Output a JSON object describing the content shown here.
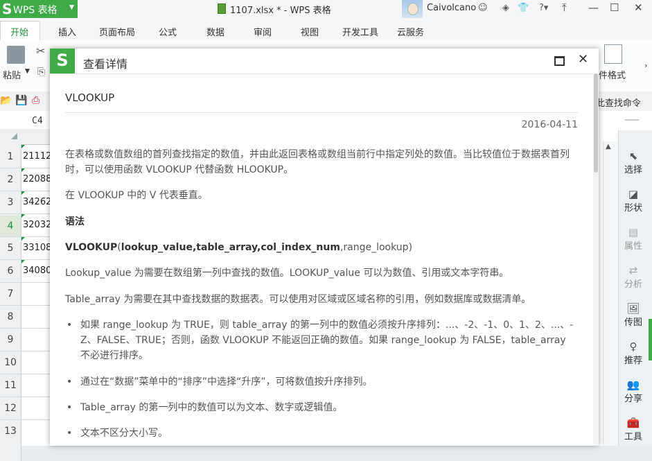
{
  "app": {
    "logo_letter": "S",
    "name": "WPS 表格",
    "window_title": "1107.xlsx * - WPS 表格",
    "username": "Caivolcano"
  },
  "ribbon_tabs": [
    "开始",
    "插入",
    "页面布局",
    "公式",
    "数据",
    "审阅",
    "视图",
    "开发工具",
    "云服务"
  ],
  "ribbon": {
    "paste_label": "粘贴",
    "cell_format_label": "件格式",
    "find_command_label": "此查找命令"
  },
  "sheet": {
    "name_box": "C4",
    "rows": [
      "1",
      "2",
      "3",
      "4",
      "5",
      "6",
      "7",
      "8",
      "9",
      "10",
      "11",
      "12",
      "13"
    ],
    "active_row": "4",
    "cells": [
      "21112",
      "22088",
      "34262",
      "32032",
      "33108",
      "34080"
    ]
  },
  "right_pane": [
    {
      "label": "选择",
      "icon": "cursor-icon",
      "enabled": true
    },
    {
      "label": "形状",
      "icon": "shapes-icon",
      "enabled": true
    },
    {
      "label": "属性",
      "icon": "properties-icon",
      "enabled": false
    },
    {
      "label": "分析",
      "icon": "analysis-icon",
      "enabled": false
    },
    {
      "label": "传图",
      "icon": "image-upload-icon",
      "enabled": true
    },
    {
      "label": "推荐",
      "icon": "recommend-icon",
      "enabled": true
    },
    {
      "label": "分享",
      "icon": "share-icon",
      "enabled": true
    },
    {
      "label": "工具",
      "icon": "toolbox-icon",
      "enabled": true
    }
  ],
  "dialog": {
    "logo_letter": "S",
    "title": "查看详情",
    "function_name": "VLOOKUP",
    "date": "2016-04-11",
    "para1": "在表格或数值数组的首列查找指定的数值，并由此返回表格或数组当前行中指定列处的数值。当比较值位于数据表首列时，可以使用函数 VLOOKUP 代替函数 HLOOKUP。",
    "para2": "在 VLOOKUP 中的 V 代表垂直。",
    "syntax_heading": "语法",
    "syntax": {
      "fn": "VLOOKUP",
      "open": "(",
      "arg1": "lookup_value",
      "arg2": "table_array",
      "arg3": "col_index_num",
      "arg4": "range_lookup",
      "close": ")",
      "comma": ","
    },
    "para_lookup": "Lookup_value  为需要在数组第一列中查找的数值。LOOKUP_value 可以为数值、引用或文本字符串。",
    "para_table": "Table_array  为需要在其中查找数据的数据表。可以使用对区域或区域名称的引用，例如数据库或数据清单。",
    "bullets": [
      "如果 range_lookup 为 TRUE，则 table_array  的第一列中的数值必须按升序排列：...、-2、-1、0、1、2、...、-Z、FALSE、TRUE；否则，函数 VLOOKUP 不能返回正确的数值。如果  range_lookup 为 FALSE，table_array 不必进行排序。",
      "通过在“数据”菜单中的“排序”中选择“升序”，可将数值按升序排列。",
      "Table_array 的第一列中的数值可以为文本、数字或逻辑值。",
      "文本不区分大小写。"
    ]
  }
}
